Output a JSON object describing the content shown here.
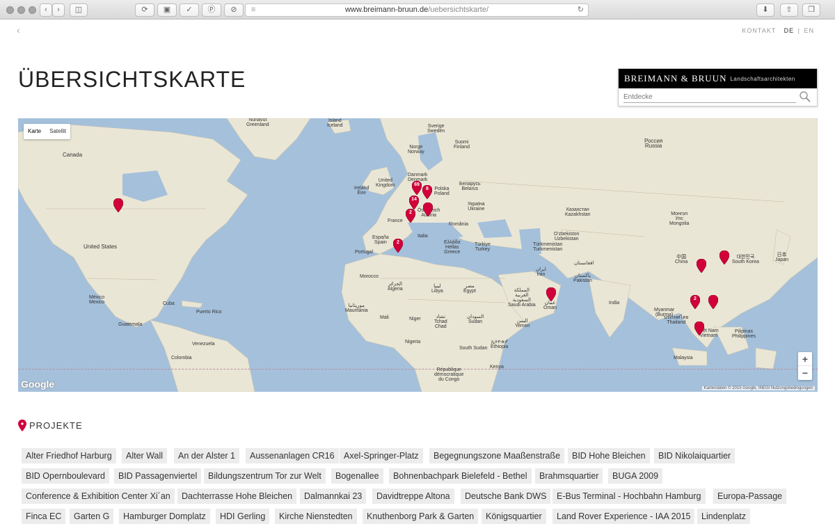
{
  "browser": {
    "url_host": "www.breimann-bruun.de",
    "url_path": "/uebersichtskarte/"
  },
  "header": {
    "back": "‹",
    "nav_contact": "KONTAKT",
    "lang_de": "DE",
    "lang_sep": "|",
    "lang_en": "EN",
    "title": "ÜBERSICHTSKARTE",
    "brand_name": "BREIMANN & BRUUN",
    "brand_sub": "Landschaftsarchitekten",
    "search_placeholder": "Entdecke"
  },
  "map": {
    "type_map": "Karte",
    "type_satellite": "Satellit",
    "zoom_in": "+",
    "zoom_out": "−",
    "logo": "Google",
    "credits": "Kartendaten © 2015 Google, INEGI   Nutzungsbedingungen",
    "labels": {
      "nunavut_greenland": "Nunavut\nGreenland",
      "iceland": "Island\nIceland",
      "sverige": "Sverige\nSweden",
      "norge": "Norge\nNorway",
      "suomi": "Suomi\nFinland",
      "russia": "Россия\nRussia",
      "canada": "Canada",
      "united_kingdom": "United\nKingdom",
      "ireland": "Ireland\nÉire",
      "danmark": "Danmark\nDenmark",
      "belarus": "Беларусь\nBelarus",
      "polska": "Polska\nPoland",
      "ukraine": "Україна\nUkraine",
      "kazakhstan": "Казахстан\nKazakhstan",
      "mongolia": "Монгол\nУлс\nMongolia",
      "france": "France",
      "romania": "România",
      "austria": "Österreich\nAustria",
      "italia": "Italia",
      "spain": "España\nSpain",
      "portugal": "Portugal",
      "hellas": "Ελλάδα\nHellas\nGreece",
      "turkiye": "Türkiye\nTurkey",
      "uzbekistan": "O'zbekiston\nUzbekistan",
      "turkmenistan": "Türkmenistan\nTurkmenistan",
      "china": "中国\nChina",
      "south_korea": "대한민국\nSouth Korea",
      "japan": "日本\nJapan",
      "iran": "ایران\nIran",
      "afghanistan": "افغانستان",
      "pakistan": "پاکستان\nPakistan",
      "united_states": "United States",
      "mexico": "México\nMexico",
      "morocco": "Morocco",
      "algeria": "الجزائر\nAlgeria",
      "libya": "ليبيا\nLibya",
      "egypt": "مصر\nEgypt",
      "saudi": "المملكة\nالعربية\nالسعودية\nSaudi Arabia",
      "oman": "عمان\nOman",
      "yemen": "اليمن\nYemen",
      "india": "India",
      "myanmar": "Myanmar\n(Burma)",
      "thailand": "ประเทศไทย\nThailand",
      "vietnam": "Việt Nam\nVietnam",
      "philippines": "Pilipinas\nPhilippines",
      "malaysia": "Malaysia",
      "mauritania": "موريتانيا\nMauritania",
      "mali": "Mali",
      "niger": "Niger",
      "chad": "تشاد\nTchad\nChad",
      "sudan": "السودان\nSudan",
      "south_sudan": "South Sudan",
      "ethiopia": "ኢትዮጵያ\nEthiopia",
      "nigeria": "Nigeria",
      "kenya": "Kenya",
      "drc": "République\ndémocratique\ndu Congo",
      "venezuela": "Venezuela",
      "colombia": "Colombia",
      "cuba": "Cuba",
      "puerto_rico": "Puerto Rico",
      "guatemala": "Guatemala"
    },
    "pins": [
      {
        "label": ""
      },
      {
        "label": "69"
      },
      {
        "label": "8"
      },
      {
        "label": "14"
      },
      {
        "label": "2"
      },
      {
        "label": ""
      },
      {
        "label": "2"
      },
      {
        "label": ""
      },
      {
        "label": ""
      },
      {
        "label": ""
      },
      {
        "label": "2"
      },
      {
        "label": ""
      },
      {
        "label": ""
      }
    ]
  },
  "projects": {
    "heading": "PROJEKTE",
    "items": [
      "Alter Friedhof Harburg",
      "Alter Wall",
      "An der Alster 1",
      "Aussenanlagen CR16",
      "Axel-Springer-Platz",
      "Begegnungszone Maaßenstraße",
      "BID Hohe Bleichen",
      "BID Nikolaiquartier",
      "BID Opernboulevard",
      "BID Passagenviertel",
      "Bildungszentrum Tor zur Welt",
      "Bogenallee",
      "Bohnenbachpark Bielefeld - Bethel",
      "Brahmsquartier",
      "BUGA 2009",
      "Conference & Exhibition Center Xi´an",
      "Dachterrasse Hohe Bleichen",
      "Dalmannkai 23",
      "Davidtreppe Altona",
      "Deutsche Bank DWS",
      "E-Bus Terminal - Hochbahn Hamburg",
      "Europa-Passage",
      "Finca EC",
      "Garten G",
      "Hamburger Domplatz",
      "HDI Gerling",
      "Kirche Nienstedten",
      "Knuthenborg Park & Garten",
      "Königsquartier",
      "Land Rover Experience - IAA 2015",
      "Lindenplatz"
    ]
  }
}
